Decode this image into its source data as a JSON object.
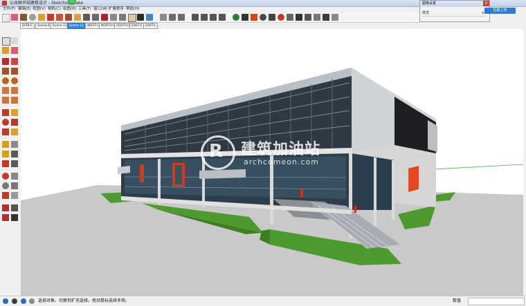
{
  "window": {
    "title": "公共图书馆建筑设计 - SketchUp Make",
    "badge": "12"
  },
  "menu": [
    "文件(F)",
    "编辑(E)",
    "视图(V)",
    "相机(C)",
    "绘图(R)",
    "工具(T)",
    "窗口(W)",
    "扩展程序",
    "帮助(H)"
  ],
  "scene_tabs": [
    {
      "label": "DIT8-C",
      "active": false
    },
    {
      "label": "Scene 8",
      "active": false
    },
    {
      "label": "Scene 11",
      "active": false
    },
    {
      "label": "Scene 12",
      "active": true
    },
    {
      "label": "WEST-C",
      "active": false
    },
    {
      "label": "NORTH-C",
      "active": false
    },
    {
      "label": "SOUTH-L",
      "active": false
    },
    {
      "label": "EAST-C",
      "active": false
    },
    {
      "label": "EAST-L",
      "active": false
    }
  ],
  "tray": {
    "title": "图像设置",
    "row_label": "样式",
    "close": "×"
  },
  "upload_button": "拉取上传",
  "watermark": {
    "letter": "R",
    "name": "建筑加油站",
    "url": "archcomeon.com"
  },
  "status": {
    "hint": "选择对象。切换到扩充选择。拖动鼠标选择多项。",
    "measure_label": "数值",
    "measure_value": ""
  },
  "colors": {
    "accent": "#3a86d6",
    "ground": "#c6c6c6",
    "grass": "#4f9a2e",
    "glass": "#2c3e4c",
    "wall": "#d8d8d8",
    "red": "#d23a1e"
  },
  "toolbar_icons": [
    "select-icon",
    "eraser-icon",
    "pencil-icon",
    "circle-icon",
    "push-pull-icon",
    "move-icon",
    "rotate-icon",
    "scale-icon",
    "offset-icon",
    "tape-icon",
    "text-icon",
    "axes-icon",
    "orbit-icon",
    "pan-icon",
    "zoom-icon",
    "zoom-extents-icon",
    "components-icon",
    "materials-icon",
    "styles-icon",
    "layers-icon",
    "section-icon",
    "iso-view-icon",
    "top-view-icon",
    "front-view-icon",
    "right-view-icon",
    "back-view-icon",
    "left-view-icon",
    "xray-icon",
    "wireframe-icon",
    "hidden-line-icon",
    "shaded-icon",
    "textured-icon",
    "monochrome-icon",
    "sandbox-icon",
    "shadow-icon",
    "fog-icon",
    "warehouse-icon",
    "extension-icon"
  ]
}
